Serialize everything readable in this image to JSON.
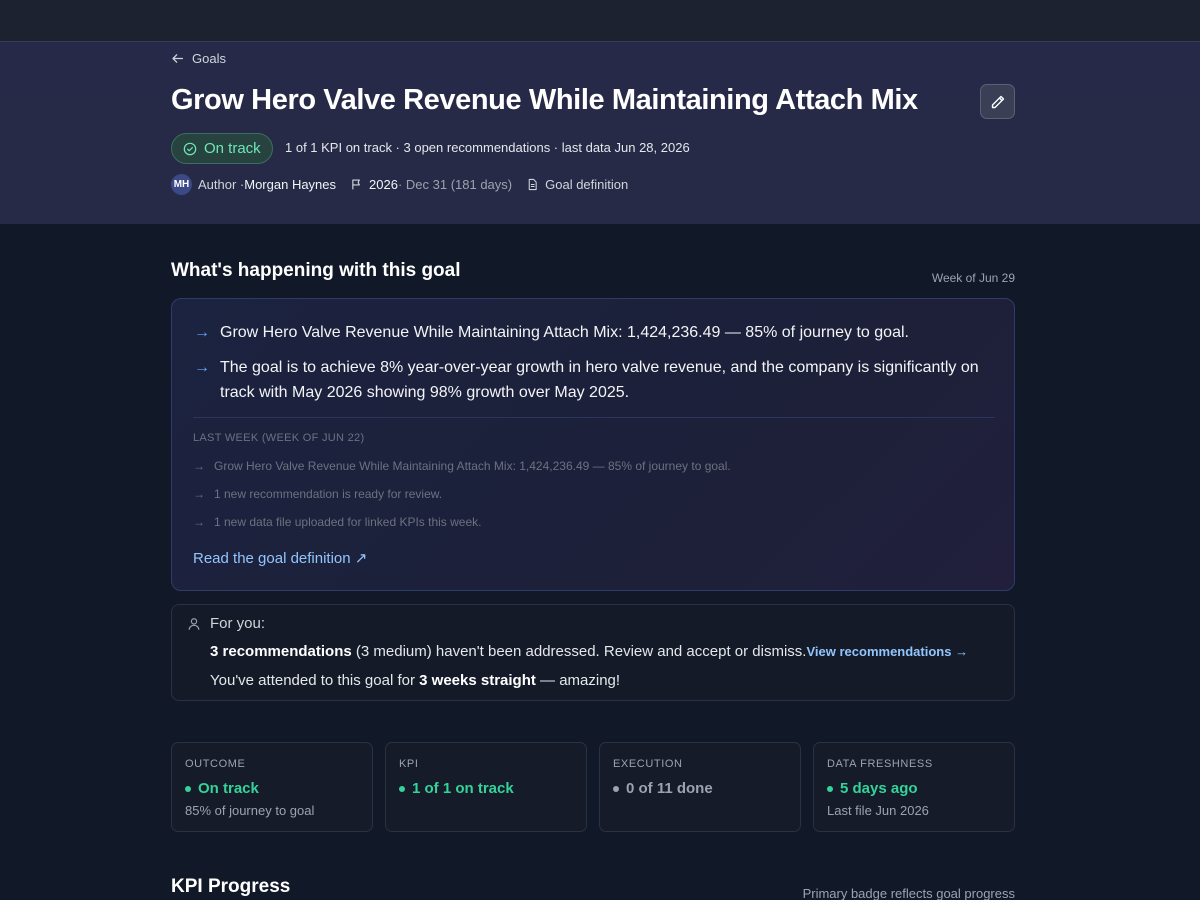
{
  "header": {
    "back_label": "Goals",
    "title": "Grow Hero Valve Revenue While Maintaining Attach Mix",
    "status": "On track",
    "status_meta": "1 of 1 KPI on track · 3 open recommendations · last data Jun 28, 2026",
    "avatar_initials": "MH",
    "author_prefix": "Author · ",
    "author_name": "Morgan Haynes",
    "period_year": "2026",
    "period_range": " · Dec 31 (181 days)",
    "definition_label": "Goal definition"
  },
  "summary": {
    "section_title": "What's happening with this goal",
    "week_label": "Week of Jun 29",
    "bullets": [
      "Grow Hero Valve Revenue While Maintaining Attach Mix: 1,424,236.49 — 85% of journey to goal.",
      "The goal is to achieve 8% year-over-year growth in hero valve revenue, and the company is significantly on track with May 2026 showing 98% growth over May 2025."
    ],
    "last_week_title": "LAST WEEK (WEEK OF JUN 22)",
    "last_week_items": [
      "Grow Hero Valve Revenue While Maintaining Attach Mix: 1,424,236.49 — 85% of journey to goal.",
      "1 new recommendation is ready for review.",
      "1 new data file uploaded for linked KPIs this week."
    ],
    "read_link": "Read the goal definition ↗"
  },
  "for_you": {
    "heading": "For you:",
    "rec_count": "3 recommendations",
    "rec_text": " (3 medium) haven't been addressed. Review and accept or dismiss.",
    "rec_link": "View recommendations →",
    "streak_prefix": "You've attended to this goal for ",
    "streak_bold": "3 weeks straight",
    "streak_suffix": " — amazing!"
  },
  "stats": [
    {
      "label": "OUTCOME",
      "value": "On track",
      "sub": "85% of journey to goal",
      "color": "#34d399"
    },
    {
      "label": "KPI",
      "value": "1 of 1 on track",
      "sub": "",
      "color": "#34d399"
    },
    {
      "label": "EXECUTION",
      "value": "0 of 11 done",
      "sub": "",
      "color": "#9ca3af"
    },
    {
      "label": "DATA FRESHNESS",
      "value": "5 days ago",
      "sub": "Last file Jun 2026",
      "color": "#34d399"
    }
  ],
  "kpi_section": {
    "title": "KPI Progress",
    "note": "Primary badge reflects goal progress"
  },
  "icons": [
    "arrow-left-icon",
    "pencil-icon",
    "check-circle-icon",
    "flag-icon",
    "document-icon",
    "user-icon",
    "arrow-right-icon"
  ]
}
